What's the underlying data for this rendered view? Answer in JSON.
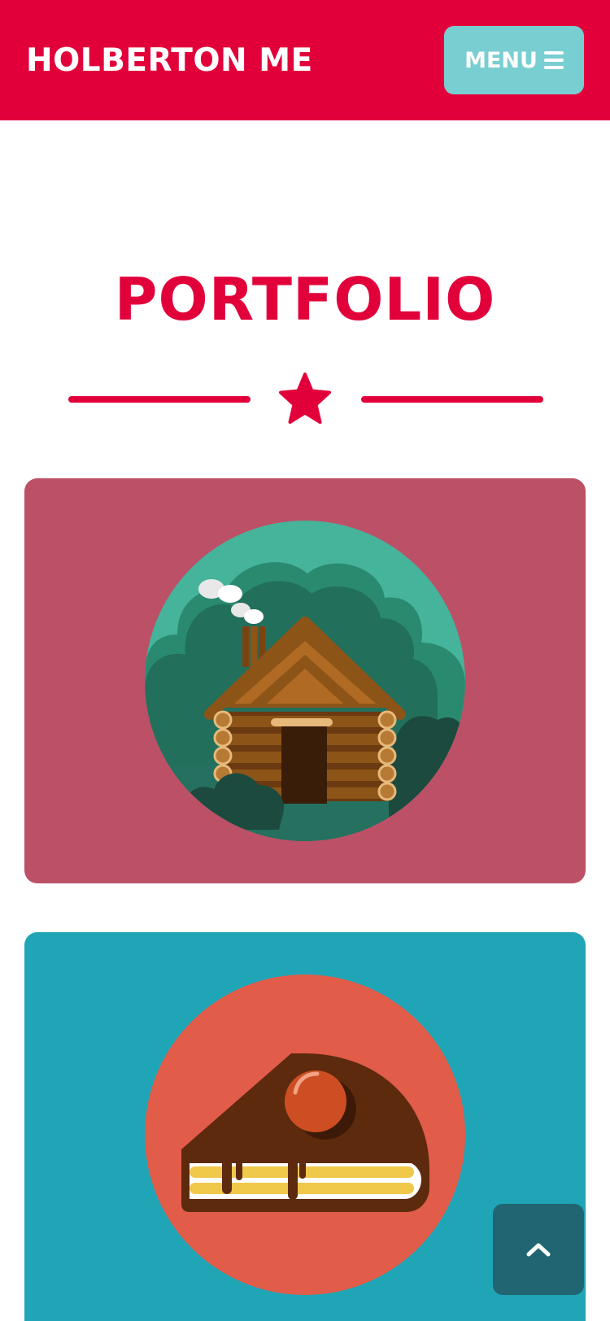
{
  "navbar": {
    "brand": "HOLBERTON ME",
    "menu_label": "MENU",
    "menu_icon": "bars-icon",
    "color": "#e2003b"
  },
  "portfolio": {
    "title": "PORTFOLIO",
    "divider_icon": "star-icon",
    "accent": "#e2003b",
    "items": [
      {
        "image": "cabin-illustration",
        "background": "#bc5066"
      },
      {
        "image": "cake-illustration",
        "background": "#20a5b6"
      }
    ]
  },
  "scroll_top": {
    "icon": "chevron-up-icon",
    "background": "#206571"
  }
}
